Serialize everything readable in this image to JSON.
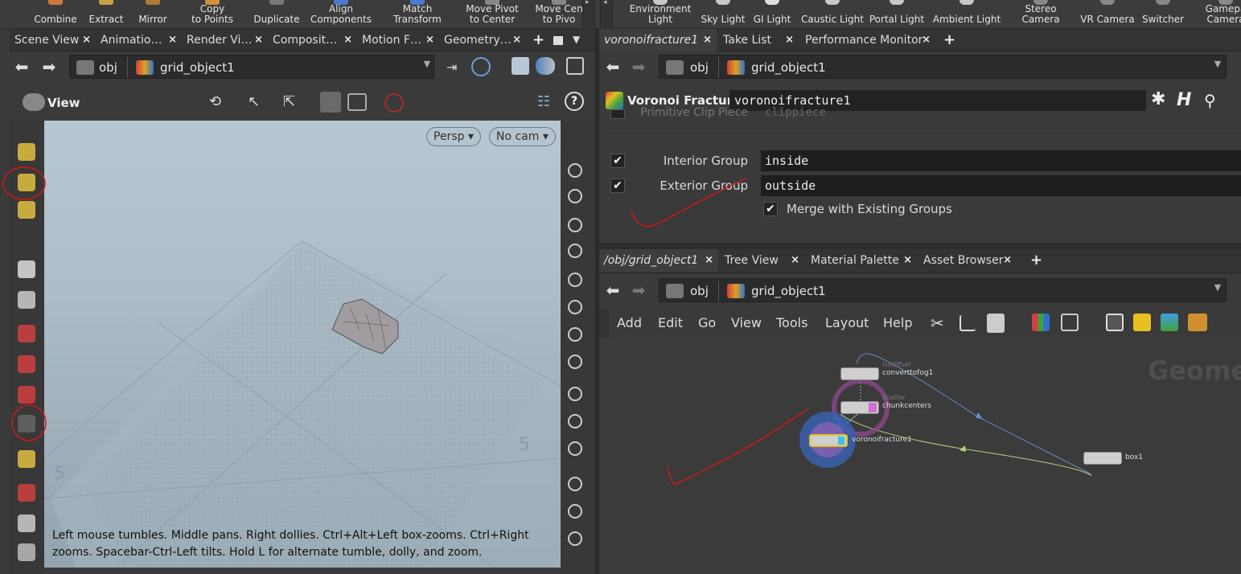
{
  "shelf": {
    "left_items": [
      {
        "label": "Combine",
        "color": "#c87a3a"
      },
      {
        "label": "Extract",
        "color": "#c8a040"
      },
      {
        "label": "Mirror",
        "color": "#b07a3a"
      },
      {
        "label_line1": "Copy",
        "label_line2": "to Points",
        "color": "#d09040"
      },
      {
        "label": "Duplicate",
        "color": "#777777"
      },
      {
        "label_line1": "Align",
        "label_line2": "Components",
        "color": "#4a7ad0"
      },
      {
        "label_line1": "Match",
        "label_line2": "Transform",
        "color": "#4a7ad0"
      },
      {
        "label_line1": "Move Pivot",
        "label_line2": "to Center",
        "color": "#888888"
      },
      {
        "label_line1": "Move Cen",
        "label_line2": "to Pivo",
        "color": "#888888"
      }
    ],
    "right_items": [
      {
        "label_line1": "Environment",
        "label_line2": "Light",
        "color": "#c8c8c8"
      },
      {
        "label": "Sky Light",
        "color": "#c8c8c8"
      },
      {
        "label": "GI Light",
        "color": "#e0e0e0"
      },
      {
        "label": "Caustic Light",
        "color": "#c8c8c8"
      },
      {
        "label": "Portal Light",
        "color": "#c8c8c8"
      },
      {
        "label": "Ambient Light",
        "color": "#c8c8c8"
      },
      {
        "label_line1": "Stereo",
        "label_line2": "Camera",
        "color": "#888888"
      },
      {
        "label": "VR Camera",
        "color": "#888888"
      },
      {
        "label": "Switcher",
        "color": "#888888"
      },
      {
        "label_line1": "Gamepa",
        "label_line2": "Camera",
        "color": "#888888"
      }
    ]
  },
  "left_pane": {
    "tabs": [
      {
        "label": "Scene View"
      },
      {
        "label": "Animatio…"
      },
      {
        "label": "Render Vi…"
      },
      {
        "label": "Composit…"
      },
      {
        "label": "Motion F…"
      },
      {
        "label": "Geometry…"
      }
    ],
    "tab_close": "×",
    "tab_plus": "+",
    "path": {
      "seg1": "obj",
      "seg2": "grid_object1"
    },
    "view_label": "View",
    "viewport": {
      "persp_label": "Persp ▾",
      "cam_label": "No cam ▾",
      "hint": "Left mouse tumbles. Middle pans. Right dollies. Ctrl+Alt+Left box-zooms. Ctrl+Right zooms. Spacebar-Ctrl-Left tilts. Hold L for alternate tumble, dolly, and zoom."
    }
  },
  "right_top": {
    "tabs": [
      {
        "label": "voronoifracture1"
      },
      {
        "label": "Take List"
      },
      {
        "label": "Performance Monitor"
      }
    ],
    "tab_close": "×",
    "tab_plus": "+",
    "path": {
      "seg1": "obj",
      "seg2": "grid_object1"
    },
    "node_type": "Voronoi Fracture",
    "node_name": "voronoifracture1",
    "params": {
      "cut_label": "Primitive Clip Piece",
      "cut_value": "clippiece",
      "interior_label": "Interior Group",
      "interior_value": "inside",
      "exterior_label": "Exterior Group",
      "exterior_value": "outside",
      "merge_label": "Merge with Existing Groups",
      "check": "✔"
    }
  },
  "right_bottom": {
    "tabs": [
      {
        "label": "/obj/grid_object1"
      },
      {
        "label": "Tree View"
      },
      {
        "label": "Material Palette"
      },
      {
        "label": "Asset Browser"
      }
    ],
    "tab_close": "×",
    "tab_plus": "+",
    "path": {
      "seg1": "obj",
      "seg2": "grid_object1"
    },
    "menu": [
      "Add",
      "Edit",
      "Go",
      "View",
      "Tools",
      "Layout",
      "Help"
    ],
    "watermark": "Geomet",
    "nodes": [
      {
        "name": "converttofog1",
        "tag": "IsoOffset"
      },
      {
        "name": "chunkcenters",
        "tag": "Scatter"
      },
      {
        "name": "voronoifracture1",
        "tag": ""
      },
      {
        "name": "box1",
        "tag": ""
      }
    ]
  },
  "colors": {
    "annotation": "#d01818",
    "selected_node": "#e8c020",
    "wire_blue": "#6a8ac8",
    "wire_green": "#b8d080"
  }
}
